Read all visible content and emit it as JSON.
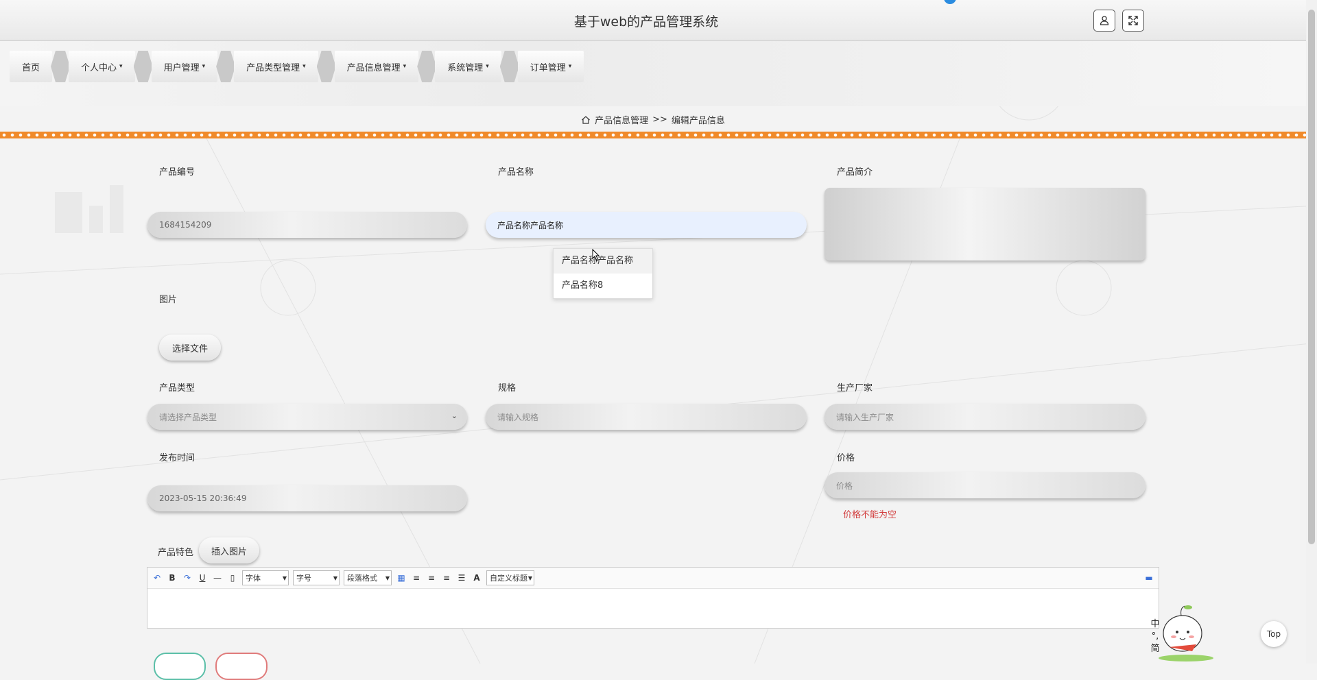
{
  "header": {
    "title": "基于web的产品管理系统",
    "user_icon": "user-icon",
    "fullscreen_icon": "fullscreen-icon"
  },
  "nav": {
    "items": [
      {
        "label": "首页",
        "has_caret": false
      },
      {
        "label": "个人中心",
        "has_caret": true
      },
      {
        "label": "用户管理",
        "has_caret": true
      },
      {
        "label": "产品类型管理",
        "has_caret": true
      },
      {
        "label": "产品信息管理",
        "has_caret": true
      },
      {
        "label": "系统管理",
        "has_caret": true
      },
      {
        "label": "订单管理",
        "has_caret": true
      }
    ],
    "caret": "▾"
  },
  "breadcrumb": {
    "home_icon": "home-icon",
    "section": "产品信息管理",
    "separator": ">>",
    "page": "编辑产品信息"
  },
  "form": {
    "product_no": {
      "label": "产品编号",
      "value": "1684154209"
    },
    "product_name": {
      "label": "产品名称",
      "value": "产品名称产品名称"
    },
    "product_intro": {
      "label": "产品简介",
      "value": ""
    },
    "image": {
      "label": "图片",
      "button": "选择文件"
    },
    "product_type": {
      "label": "产品类型",
      "placeholder": "请选择产品类型"
    },
    "spec": {
      "label": "规格",
      "placeholder": "请输入规格"
    },
    "manufacturer": {
      "label": "生产厂家",
      "placeholder": "请输入生产厂家"
    },
    "publish_time": {
      "label": "发布时间",
      "value": "2023-05-15 20:36:49"
    },
    "price": {
      "label": "价格",
      "placeholder": "价格",
      "error": "价格不能为空"
    },
    "features": {
      "label": "产品特色",
      "insert_image_button": "插入图片"
    }
  },
  "autocomplete": {
    "options": [
      "产品名称产品名称",
      "产品名称8"
    ]
  },
  "editor": {
    "font_select": "字体",
    "size_select": "字号",
    "paragraph_select": "段落格式",
    "custom_title_select": "自定义标题",
    "bold": "B",
    "underline": "U",
    "color": "A"
  },
  "ime": {
    "chars": [
      "中",
      "°,",
      "简"
    ]
  },
  "top_button": "Top"
}
